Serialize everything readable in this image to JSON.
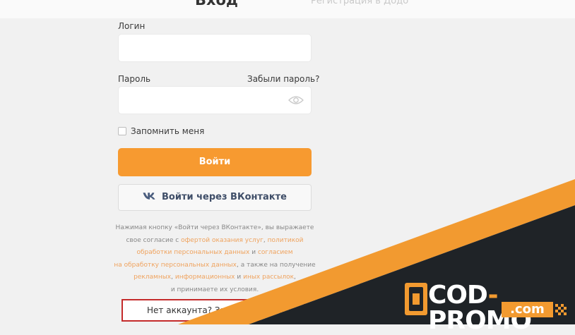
{
  "header": {
    "title": "Вход",
    "faded_tab": "Регистрация в Додо"
  },
  "form": {
    "login_label": "Логин",
    "login_value": "",
    "password_label": "Пароль",
    "password_value": "",
    "forgot_link": "Забыли пароль?",
    "remember_label": "Запомнить меня",
    "login_button": "Войти",
    "vk_button": "Войти через ВКонтакте"
  },
  "terms": {
    "line1": "Нажимая кнопку «Войти через ВКонтакте», вы выражаете",
    "line2_pre": "свое согласие с ",
    "line2_link1": "офертой оказания услуг",
    "line2_sep": ", ",
    "line2_link2": "политикой",
    "line3_link": "обработки персональных данных",
    "line3_mid": " и ",
    "line3_link2": "согласием",
    "line4_link": "на обработку персональных данных",
    "line4_post": ", а также на получение",
    "line5_link1": "рекламных",
    "line5_sep1": ", ",
    "line5_link2": "информационных",
    "line5_mid": " и ",
    "line5_link3": "иных рассылок",
    "line5_end": ",",
    "line6": "и принимаете их условия."
  },
  "register": {
    "text": "Нет аккаунта? Зарегистрироваться"
  },
  "watermark": {
    "brand_left": "COD",
    "dash": "-",
    "brand_right": "PROMO",
    "sub": ".com"
  },
  "colors": {
    "accent": "#f79a30",
    "dark_band": "#1f2327",
    "register_border": "#c42b2b",
    "link": "#f0a35e"
  },
  "icons": {
    "eye": "eye-icon",
    "vk": "vk-logo-icon",
    "brand": "cod-promo-logo-icon"
  }
}
